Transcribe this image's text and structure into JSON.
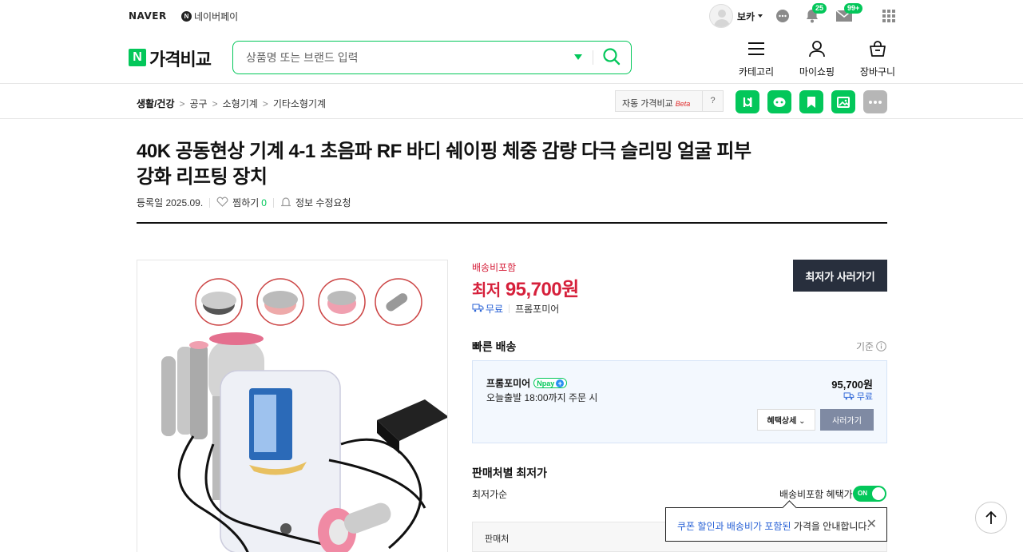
{
  "topbar": {
    "naver": "NAVER",
    "npay": "네이버페이",
    "npay_mark": "N",
    "user": "보카",
    "notif_badge": "25",
    "mail_badge": "99+"
  },
  "header": {
    "logo_mark": "N",
    "logo_text": "가격비교",
    "search_placeholder": "상품명 또는 브랜드 입력",
    "nav": [
      {
        "label": "카테고리",
        "icon": "menu-icon"
      },
      {
        "label": "마이쇼핑",
        "icon": "person-icon"
      },
      {
        "label": "장바구니",
        "icon": "basket-icon"
      }
    ]
  },
  "breadcrumb": [
    "생활/건강",
    "공구",
    "소형기계",
    "기타소형기계"
  ],
  "breadcrumb_sep": ">",
  "auto_compare": {
    "label": "자동 가격비교",
    "beta": "Beta",
    "help": "?"
  },
  "share_icons": [
    "blog-icon",
    "talk-icon",
    "bookmark-icon",
    "photo-icon",
    "more-icon"
  ],
  "product": {
    "title": "40K 공동현상 기계 4-1 초음파 RF 바디 쉐이핑 체중 감량 다극 슬리밍 얼굴 피부 강화 리프팅 장치",
    "registered": "등록일 2025.09.",
    "wish_label": "찜하기",
    "wish_count": "0",
    "report": "정보 수정요청"
  },
  "price_panel": {
    "shipping_included": "배송비포함",
    "lowest_label": "최저",
    "lowest_price": "95,700원",
    "ship_free": "무료",
    "mall": "프롬포미어",
    "buy_button": "최저가 사러가기"
  },
  "fast_delivery": {
    "title": "빠른 배송",
    "standard": "기준",
    "mall": "프롬포미어",
    "npay_badge": "pay",
    "npay_badge_mark": "N",
    "npay_badge_plus": "+",
    "delivery_note": "오늘출발 18:00까지 주문 시",
    "price": "95,700원",
    "ship": "무료",
    "benefit_button": "혜택상세",
    "buy_button": "사러가기"
  },
  "seller_section": {
    "title": "판매처별 최저가",
    "sort": "최저가순",
    "toggle_label": "배송비포함 혜택가",
    "toggle_state": "ON",
    "table_header": "판매처"
  },
  "tooltip": {
    "highlight": "쿠폰 할인과 배송비가 포함된",
    "rest": " 가격을 안내합니다.",
    "close": "✕"
  },
  "colors": {
    "brand_green": "#03c75a",
    "price_red": "#d6203b",
    "button_dark": "#282f3d",
    "link_blue": "#2962d6"
  }
}
